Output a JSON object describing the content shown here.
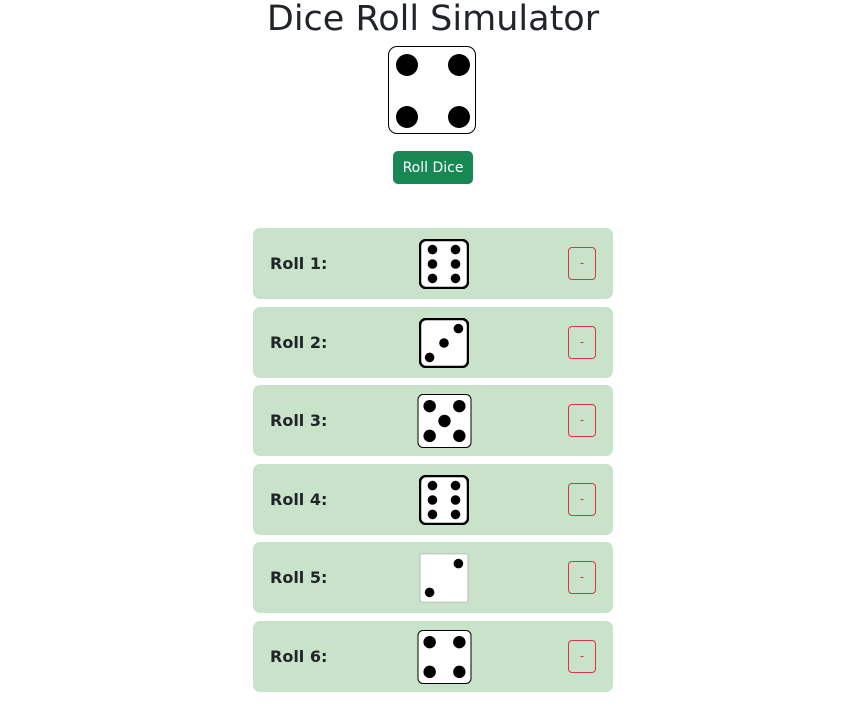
{
  "app": {
    "title": "Dice Roll Simulator"
  },
  "current_die": {
    "value": 4
  },
  "roll_button": {
    "label": "Roll Dice",
    "color": "#198754"
  },
  "history": {
    "row_color": "#c8e3c9",
    "remove_color": "#dc3545",
    "rolls": [
      {
        "label": "Roll 1:",
        "value": 6,
        "remove_label": "-"
      },
      {
        "label": "Roll 2:",
        "value": 3,
        "remove_label": "-"
      },
      {
        "label": "Roll 3:",
        "value": 5,
        "remove_label": "-"
      },
      {
        "label": "Roll 4:",
        "value": 6,
        "remove_label": "-"
      },
      {
        "label": "Roll 5:",
        "value": 2,
        "remove_label": "-"
      },
      {
        "label": "Roll 6:",
        "value": 4,
        "remove_label": "-"
      }
    ]
  }
}
